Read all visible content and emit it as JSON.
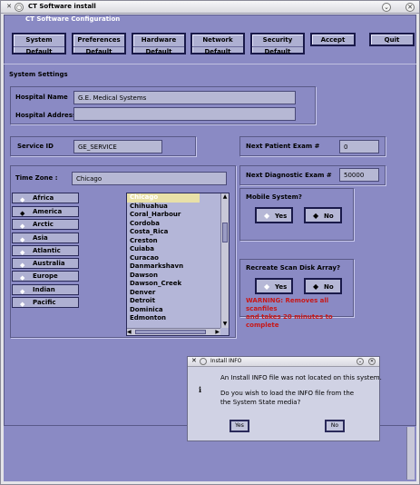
{
  "window": {
    "title": "CT Software install",
    "subtitle": "CT Software Configuration"
  },
  "nav": [
    {
      "top": "System",
      "bottom": "Default"
    },
    {
      "top": "Preferences",
      "bottom": "Default"
    },
    {
      "top": "Hardware",
      "bottom": "Default"
    },
    {
      "top": "Network",
      "bottom": "Default"
    },
    {
      "top": "Security",
      "bottom": "Default"
    },
    {
      "top": "Accept",
      "bottom": ""
    },
    {
      "top": "Quit",
      "bottom": ""
    }
  ],
  "section_title": "System Settings",
  "hospital": {
    "name_label": "Hospital Name",
    "name_value": "G.E. Medical Systems",
    "address_label": "Hospital Address",
    "address_value": ""
  },
  "service": {
    "label": "Service ID",
    "value": "GE_SERVICE"
  },
  "next_patient": {
    "label": "Next Patient Exam #",
    "value": "0"
  },
  "next_diagnostic": {
    "label": "Next Diagnostic Exam #",
    "value": "50000"
  },
  "timezone": {
    "label": "Time Zone :",
    "value": "Chicago",
    "regions": [
      "Africa",
      "America",
      "Arctic",
      "Asia",
      "Atlantic",
      "Australia",
      "Europe",
      "Indian",
      "Pacific"
    ],
    "selected_region": "America",
    "cities": [
      "Chicago",
      "Chihuahua",
      "Coral_Harbour",
      "Cordoba",
      "Costa_Rica",
      "Creston",
      "Cuiaba",
      "Curacao",
      "Danmarkshavn",
      "Dawson",
      "Dawson_Creek",
      "Denver",
      "Detroit",
      "Dominica",
      "Edmonton"
    ],
    "selected_city": "Chicago"
  },
  "mobile": {
    "label": "Mobile System?",
    "yes": "Yes",
    "no": "No",
    "selected": "No"
  },
  "recreate": {
    "label": "Recreate Scan Disk Array?",
    "yes": "Yes",
    "no": "No",
    "selected": "No",
    "warning_line1": "WARNING: Removes all scanfiles",
    "warning_line2": "and takes 20 minutes to complete"
  },
  "dialog": {
    "title": "Install INFO",
    "icon": "i",
    "line1": "An Install INFO file was not located on this system.",
    "line2": "Do you wish to load the INFO file from the",
    "line3": "the System State media?",
    "yes": "Yes",
    "no": "No"
  },
  "colors": {
    "panel": "#8a8ac4",
    "warning": "#c81818",
    "button": "#aeb0d2"
  }
}
